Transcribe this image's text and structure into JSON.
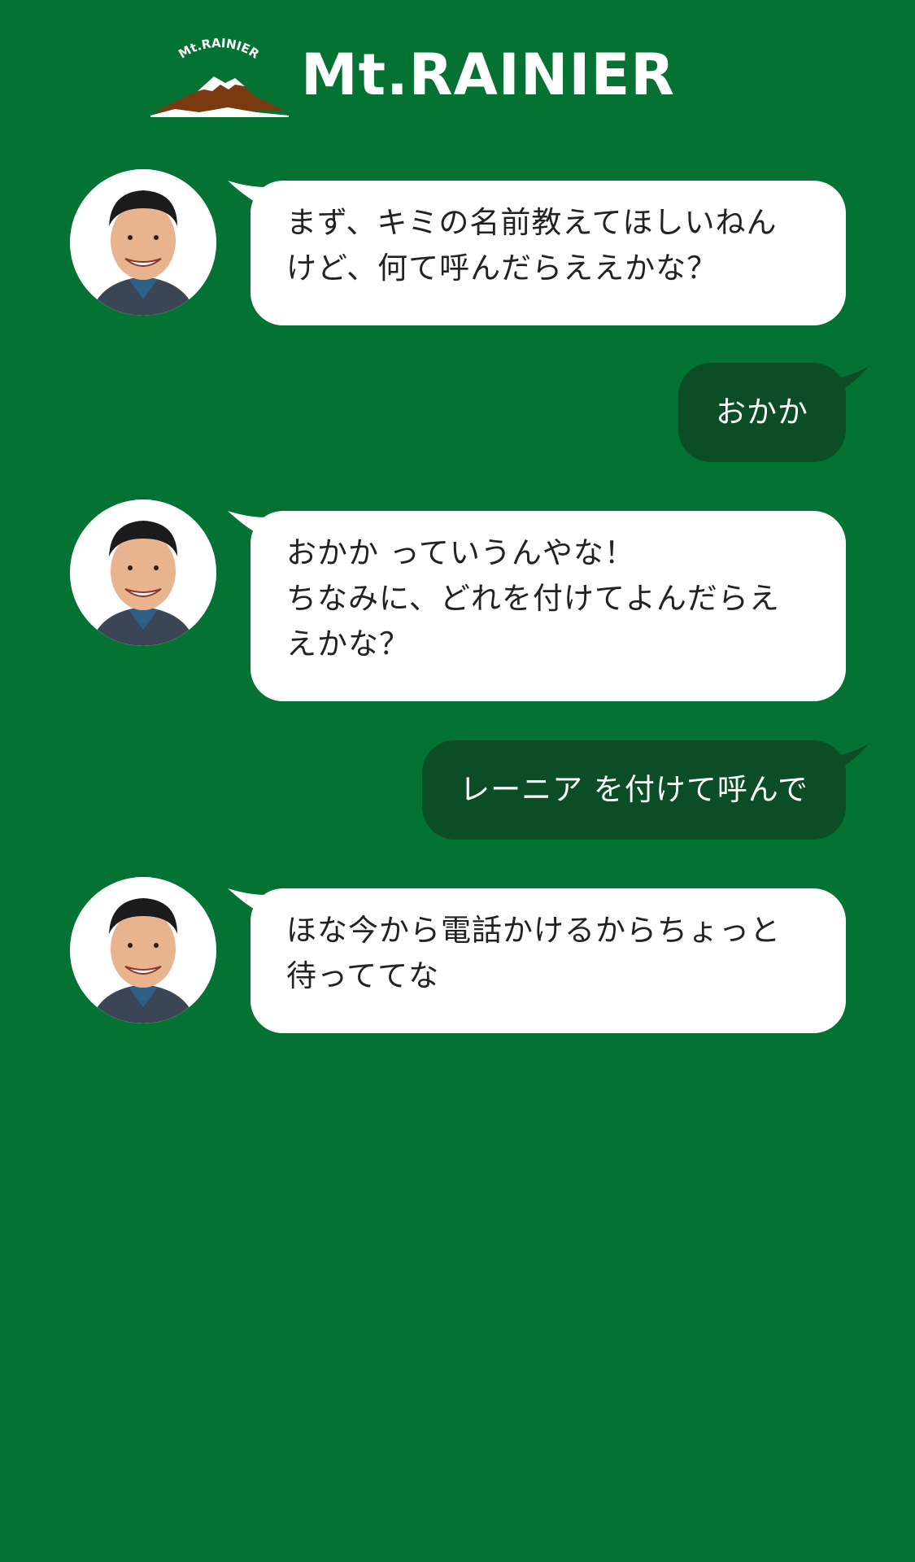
{
  "brand": {
    "name": "Mt.RAINIER",
    "emblem_text": "Mt.RAINIER"
  },
  "messages": [
    {
      "from": "bot",
      "text": "まず、キミの名前教えてほしいねん\nけど、何て呼んだらええかな？"
    },
    {
      "from": "user",
      "text": "おかか"
    },
    {
      "from": "bot",
      "text": "おかか っていうんやな！\nちなみに、どれを付けてよんだらえ\nえかな？"
    },
    {
      "from": "user",
      "text": "レーニア を付けて呼んで"
    },
    {
      "from": "bot",
      "text": "ほな今から電話かけるからちょっと\n待っててな"
    }
  ],
  "colors": {
    "background": "#037233",
    "user_bubble": "#0b4d25",
    "bot_bubble": "#ffffff"
  }
}
